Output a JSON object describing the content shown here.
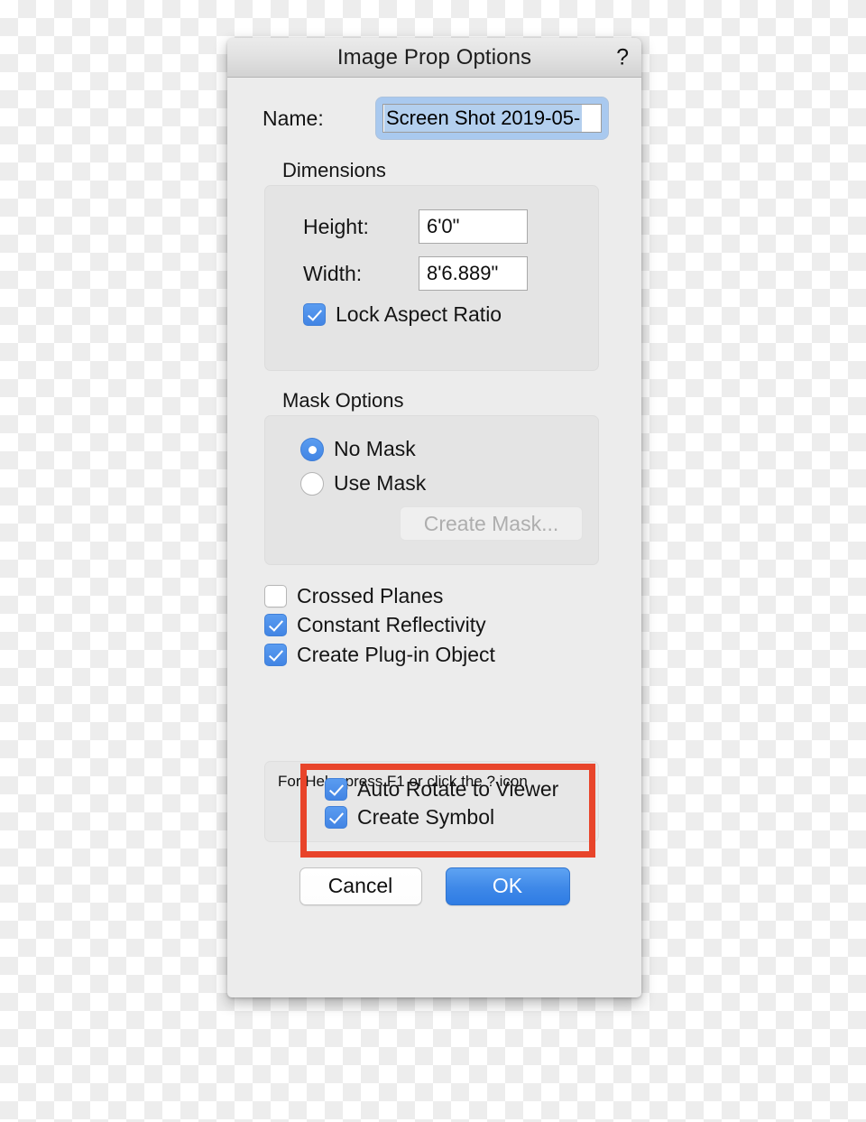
{
  "window": {
    "title": "Image Prop Options",
    "help_icon": "question-mark-icon"
  },
  "name_row": {
    "label": "Name:",
    "value": "Screen Shot 2019-05-",
    "selected": true
  },
  "dimensions": {
    "group_title": "Dimensions",
    "height_label": "Height:",
    "height_value": "6'0\"",
    "width_label": "Width:",
    "width_value": "8'6.889\"",
    "lock_aspect_label": "Lock Aspect Ratio",
    "lock_aspect_checked": true
  },
  "mask_options": {
    "group_title": "Mask Options",
    "no_mask_label": "No Mask",
    "use_mask_label": "Use Mask",
    "selected": "No Mask",
    "create_mask_label": "Create Mask...",
    "create_mask_enabled": false
  },
  "options": {
    "crossed_planes_label": "Crossed Planes",
    "crossed_planes_checked": false,
    "constant_reflectivity_label": "Constant Reflectivity",
    "constant_reflectivity_checked": true,
    "create_plugin_object_label": "Create Plug-in Object",
    "create_plugin_object_checked": true,
    "auto_rotate_label": "Auto Rotate to Viewer",
    "auto_rotate_checked": true,
    "create_symbol_label": "Create Symbol",
    "create_symbol_checked": true
  },
  "annotation": {
    "highlight_color": "#e8442a"
  },
  "help": {
    "text": "For Help, press F1 or click the ? icon"
  },
  "footer": {
    "cancel_label": "Cancel",
    "ok_label": "OK"
  },
  "colors": {
    "accent_blue": "#4285e4",
    "selection_blue": "#b3cfee",
    "dialog_bg": "#ececec",
    "annotation_red": "#e8442a"
  }
}
